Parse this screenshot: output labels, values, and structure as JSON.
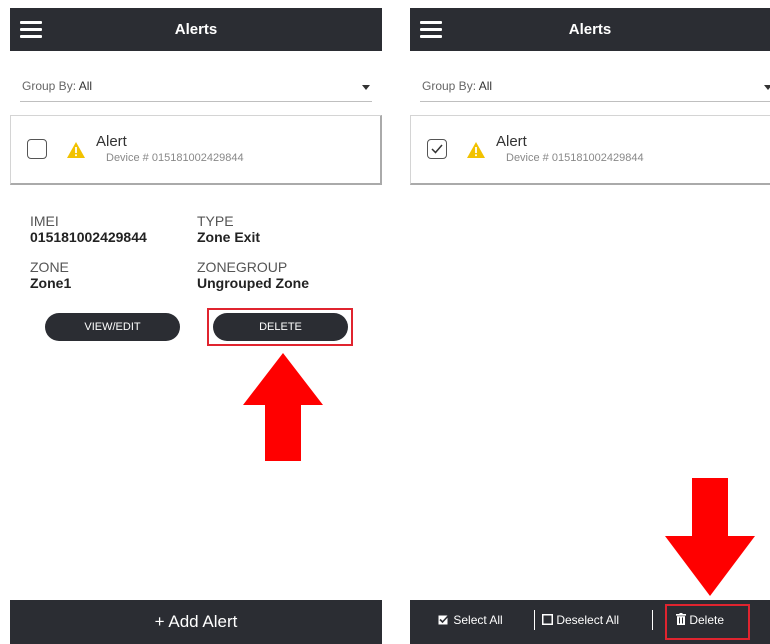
{
  "left": {
    "header": {
      "title": "Alerts"
    },
    "group_by": {
      "label": "Group By:",
      "value": "All"
    },
    "alert": {
      "title": "Alert",
      "device": "Device # 015181002429844",
      "checked": false
    },
    "details": {
      "imei_label": "IMEI",
      "imei_value": "015181002429844",
      "type_label": "TYPE",
      "type_value": "Zone Exit",
      "zone_label": "ZONE",
      "zone_value": "Zone1",
      "zonegroup_label": "ZONEGROUP",
      "zonegroup_value": "Ungrouped Zone"
    },
    "buttons": {
      "view_edit": "VIEW/EDIT",
      "delete": "DELETE"
    },
    "bottom": {
      "add_alert": "+ Add Alert"
    }
  },
  "right": {
    "header": {
      "title": "Alerts"
    },
    "group_by": {
      "label": "Group By:",
      "value": "All"
    },
    "alert": {
      "title": "Alert",
      "device": "Device # 015181002429844",
      "checked": true
    },
    "bottom": {
      "select_all": "Select All",
      "deselect_all": "Deselect All",
      "delete": "Delete"
    }
  },
  "colors": {
    "header_bg": "#2b2d33",
    "highlight_red": "#e0242f",
    "arrow_red": "#ff0000",
    "warning_yellow": "#f2c200"
  },
  "icons": [
    "hamburger-icon",
    "caret-down-icon",
    "warning-icon",
    "checkbox-icon",
    "checkmark-icon",
    "select-all-icon",
    "deselect-all-icon",
    "trash-icon",
    "arrow-up-icon",
    "arrow-down-icon"
  ]
}
